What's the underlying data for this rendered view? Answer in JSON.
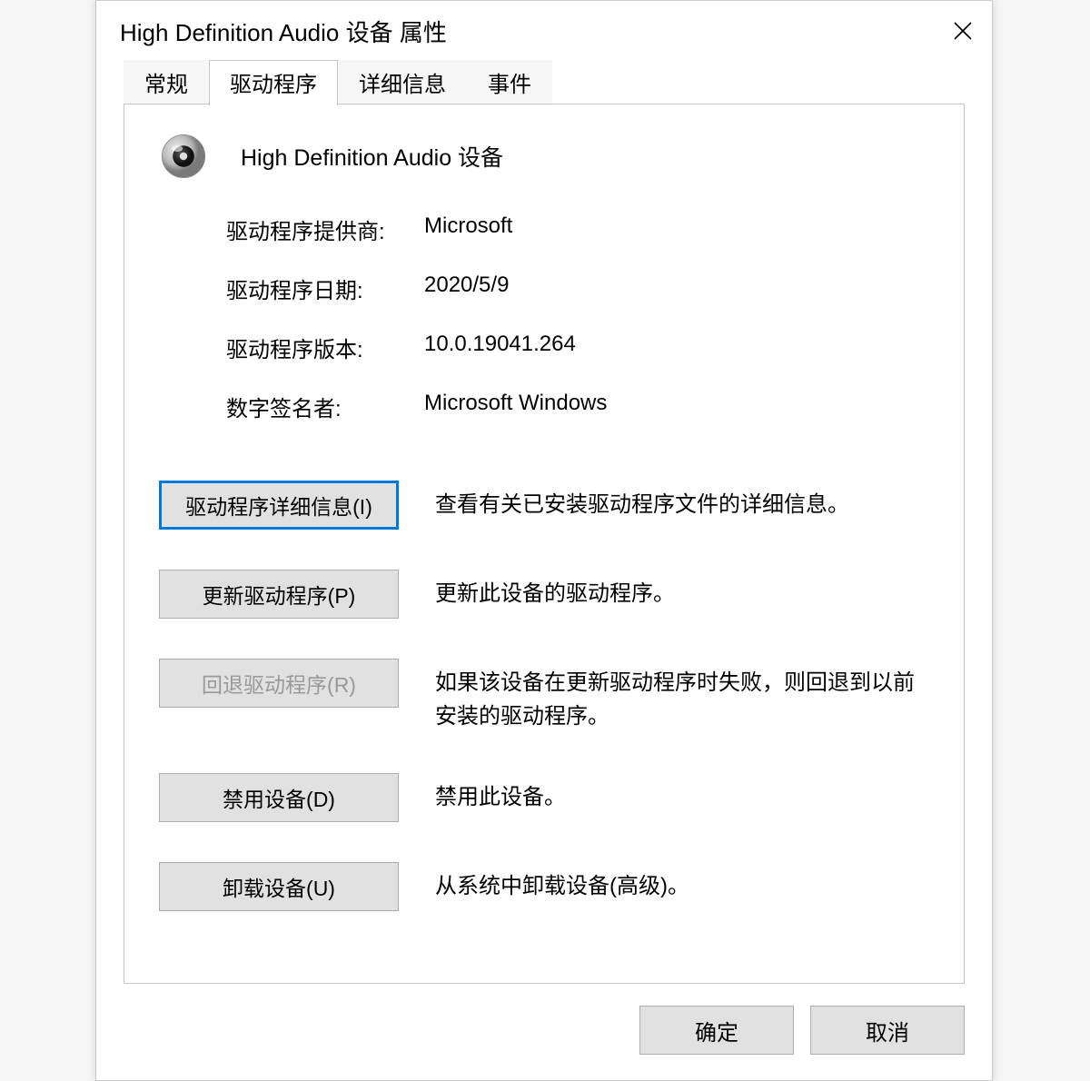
{
  "window": {
    "title": "High Definition Audio 设备 属性"
  },
  "tabs": [
    {
      "label": "常规",
      "active": false
    },
    {
      "label": "驱动程序",
      "active": true
    },
    {
      "label": "详细信息",
      "active": false
    },
    {
      "label": "事件",
      "active": false
    }
  ],
  "device": {
    "name": "High Definition Audio 设备"
  },
  "info": {
    "provider_label": "驱动程序提供商:",
    "provider_value": "Microsoft",
    "date_label": "驱动程序日期:",
    "date_value": "2020/5/9",
    "version_label": "驱动程序版本:",
    "version_value": "10.0.19041.264",
    "signer_label": "数字签名者:",
    "signer_value": "Microsoft Windows"
  },
  "actions": {
    "details": {
      "label": "驱动程序详细信息(I)",
      "desc": "查看有关已安装驱动程序文件的详细信息。"
    },
    "update": {
      "label": "更新驱动程序(P)",
      "desc": "更新此设备的驱动程序。"
    },
    "rollback": {
      "label": "回退驱动程序(R)",
      "desc": "如果该设备在更新驱动程序时失败，则回退到以前安装的驱动程序。"
    },
    "disable": {
      "label": "禁用设备(D)",
      "desc": "禁用此设备。"
    },
    "uninstall": {
      "label": "卸载设备(U)",
      "desc": "从系统中卸载设备(高级)。"
    }
  },
  "footer": {
    "ok": "确定",
    "cancel": "取消"
  }
}
